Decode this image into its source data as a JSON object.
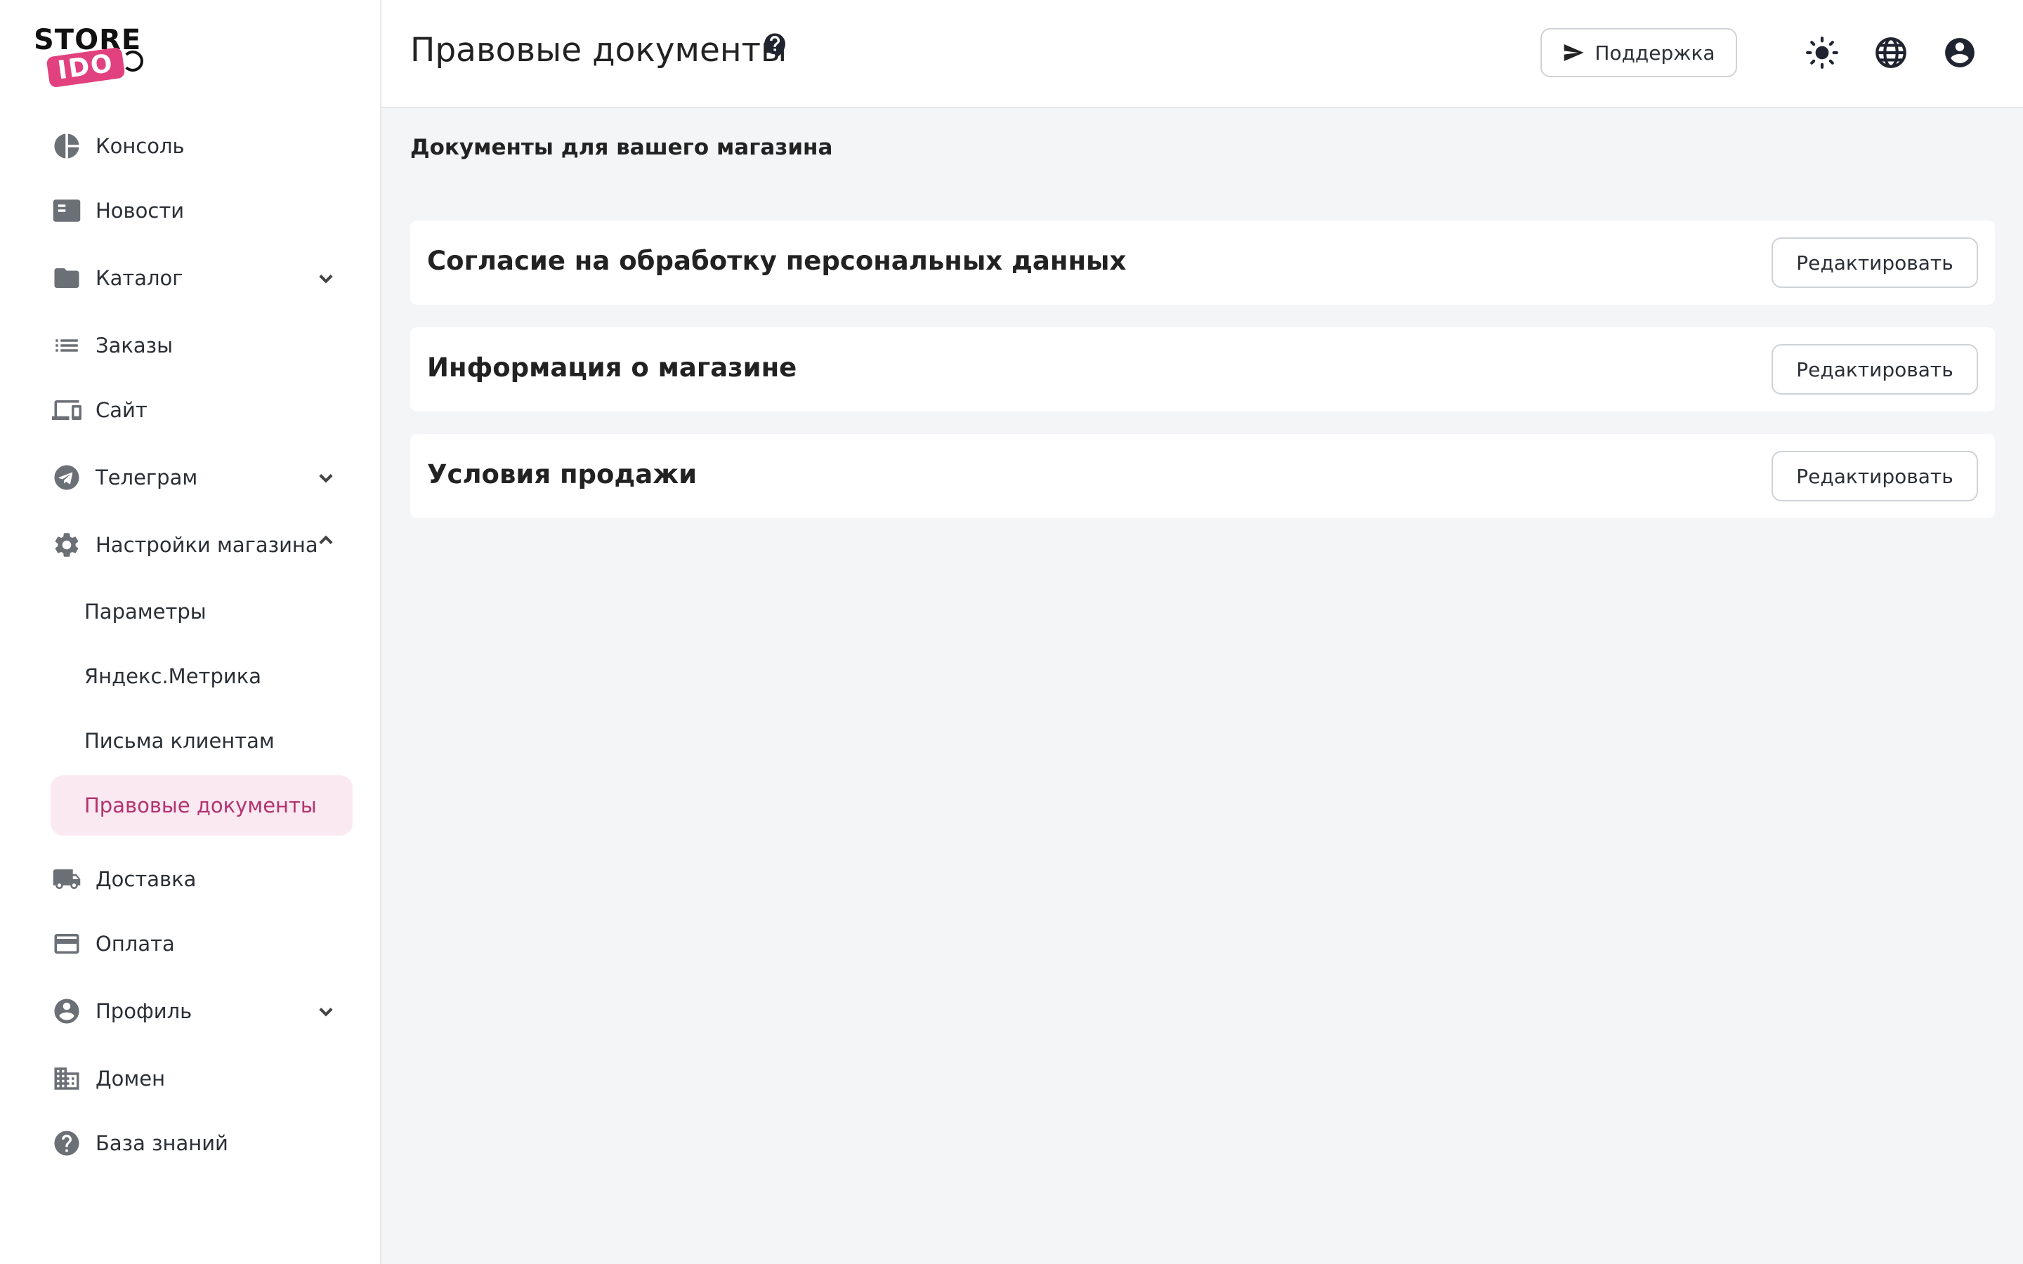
{
  "logo": {
    "line1": "STORE",
    "line2": "IDO"
  },
  "sidebar": {
    "items": [
      {
        "label": "Консоль",
        "icon": "pie-chart-icon"
      },
      {
        "label": "Новости",
        "icon": "news-icon"
      },
      {
        "label": "Каталог",
        "icon": "folder-icon",
        "chevron": "down"
      },
      {
        "label": "Заказы",
        "icon": "list-icon"
      },
      {
        "label": "Сайт",
        "icon": "devices-icon"
      },
      {
        "label": "Телеграм",
        "icon": "telegram-icon",
        "chevron": "down"
      },
      {
        "label": "Настройки магазина",
        "icon": "gear-icon",
        "chevron": "up"
      },
      {
        "label": "Доставка",
        "icon": "truck-icon"
      },
      {
        "label": "Оплата",
        "icon": "credit-card-icon"
      },
      {
        "label": "Профиль",
        "icon": "user-circle-icon",
        "chevron": "down"
      },
      {
        "label": "Домен",
        "icon": "building-icon"
      },
      {
        "label": "База знаний",
        "icon": "help-circle-icon"
      }
    ],
    "subitems": [
      {
        "label": "Параметры"
      },
      {
        "label": "Яндекс.Метрика"
      },
      {
        "label": "Письма клиентам"
      },
      {
        "label": "Правовые документы",
        "active": true
      }
    ]
  },
  "header": {
    "title": "Правовые документы",
    "support_label": "Поддержка"
  },
  "main": {
    "section_title": "Документы для вашего магазина",
    "documents": [
      {
        "title": "Согласие на обработку персональных данных",
        "button": "Редактировать"
      },
      {
        "title": "Информация о магазине",
        "button": "Редактировать"
      },
      {
        "title": "Условия продажи",
        "button": "Редактировать"
      }
    ]
  },
  "colors": {
    "accent": "#e2417f",
    "active_bg": "#fbe9f1",
    "active_text": "#b3336f",
    "background": "#f4f5f7"
  }
}
